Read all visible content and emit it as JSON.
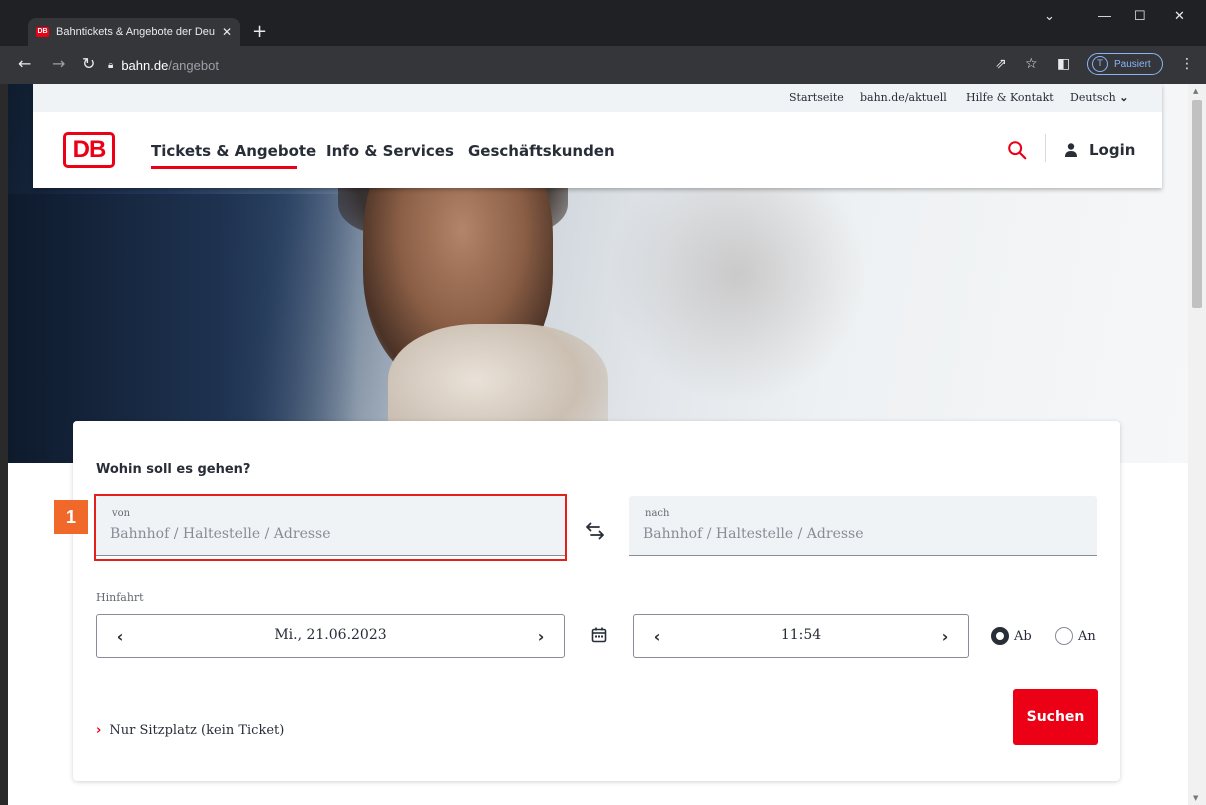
{
  "browser": {
    "tab_title": "Bahntickets & Angebote der Deu",
    "favicon_text": "DB",
    "url_host": "bahn.de",
    "url_path": "/angebot",
    "profile_initial": "T",
    "profile_label": "Pausiert",
    "icons": [
      "back-icon",
      "forward-icon",
      "reload-icon",
      "lock-icon",
      "share-icon",
      "star-icon",
      "sidepanel-icon",
      "menu-icon"
    ]
  },
  "meta_nav": {
    "items": [
      "Startseite",
      "bahn.de/aktuell",
      "Hilfe & Kontakt"
    ],
    "language": "Deutsch"
  },
  "header": {
    "logo": "DB",
    "nav": [
      "Tickets & Angebote",
      "Info & Services",
      "Geschäftskunden"
    ],
    "login_label": "Login"
  },
  "search": {
    "title": "Wohin soll es gehen?",
    "from_label": "von",
    "from_placeholder": "Bahnhof / Haltestelle / Adresse",
    "to_label": "nach",
    "to_placeholder": "Bahnhof / Haltestelle / Adresse",
    "section_label": "Hinfahrt",
    "date_value": "Mi., 21.06.2023",
    "time_value": "11:54",
    "radio_ab": "Ab",
    "radio_an": "An",
    "radio_selected": "Ab",
    "seat_only_label": "Nur Sitzplatz (kein Ticket)",
    "submit_label": "Suchen"
  },
  "annotation": {
    "step_number": "1"
  },
  "colors": {
    "brand_red": "#ec0016",
    "annotation_orange": "#f0692a",
    "highlight_red": "#e32119"
  }
}
